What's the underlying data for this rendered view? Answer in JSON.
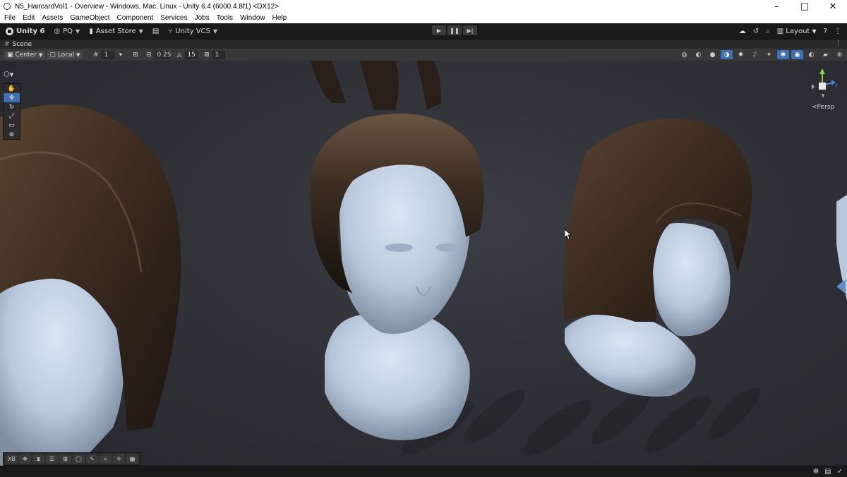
{
  "window": {
    "title": "N5_HaircardVol1 - Overview - Windows, Mac, Linux - Unity 6.4 (6000.4.8f1) <DX12>",
    "controls": {
      "minimize": "–",
      "maximize": "□",
      "close": "✕"
    }
  },
  "menu": [
    "File",
    "Edit",
    "Assets",
    "GameObject",
    "Component",
    "Services",
    "Jobs",
    "Tools",
    "Window",
    "Help"
  ],
  "toolbar": {
    "unity_label": "Unity 6",
    "account_label": "PQ",
    "asset_store_label": "Asset Store",
    "vcs_label": "Unity VCS",
    "layout_label": "Layout"
  },
  "scene_tab": {
    "label": "Scene"
  },
  "scene_toolbar": {
    "pivot_label": "Center",
    "space_label": "Local",
    "grid_value": "1",
    "snap_move_value": "0.25",
    "snap_rotate_value": "15",
    "snap_scale_value": "1"
  },
  "gizmo": {
    "projection_label": "Persp",
    "axis_label": "z"
  },
  "bottom_overlay": {
    "xr_label": "XB"
  },
  "colors": {
    "active_blue": "#3d6fb2",
    "hair_dark": "#2b1f18",
    "hair_brown": "#4a3526",
    "skin": "#b9c9dd",
    "gizmo_x": "#d94e4e",
    "gizmo_y": "#8fd14f",
    "gizmo_z": "#4f86e0"
  }
}
